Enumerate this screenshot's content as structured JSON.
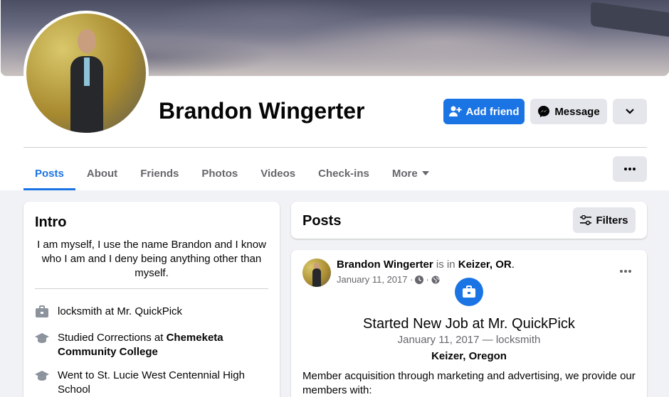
{
  "profile": {
    "name": "Brandon Wingerter",
    "buttons": {
      "add_friend": "Add friend",
      "message": "Message"
    }
  },
  "tabs": [
    "Posts",
    "About",
    "Friends",
    "Photos",
    "Videos",
    "Check-ins",
    "More"
  ],
  "intro": {
    "title": "Intro",
    "bio": "I am myself, I use the name Brandon and I know who I am and I deny being anything other than myself.",
    "work": "locksmith at Mr. QuickPick",
    "studied_prefix": "Studied Corrections at",
    "studied_school": "Chemeketa Community College",
    "went_to": "Went to St. Lucie West Centennial High School"
  },
  "posts_header": {
    "title": "Posts",
    "filters": "Filters"
  },
  "post": {
    "author": "Brandon Wingerter",
    "is_in": "is in",
    "location": "Keizer, OR",
    "date": "January 11, 2017 ·",
    "job_title": "Started New Job at Mr. QuickPick",
    "job_sub": "January 11, 2017 — locksmith",
    "job_location": "Keizer, Oregon",
    "text": "Member acquisition through marketing and advertising, we provide our members with:"
  },
  "colors": {
    "accent": "#1b74e4",
    "muted": "#65676b",
    "button_gray": "#e4e6eb"
  }
}
